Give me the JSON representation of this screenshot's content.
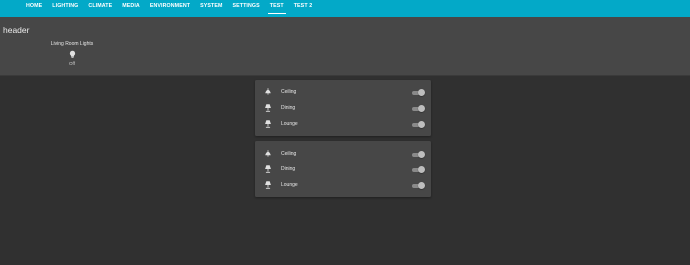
{
  "nav": {
    "tabs": [
      {
        "label": "HOME"
      },
      {
        "label": "LIGHTING"
      },
      {
        "label": "CLIMATE"
      },
      {
        "label": "MEDIA"
      },
      {
        "label": "ENVIRONMENT"
      },
      {
        "label": "SYSTEM"
      },
      {
        "label": "SETTINGS"
      },
      {
        "label": "TEST",
        "active": true
      },
      {
        "label": "TEST 2"
      }
    ]
  },
  "header": {
    "title": "header",
    "entity": {
      "name": "Living Room Lights",
      "state": "Off",
      "icon": "lightbulb-icon"
    }
  },
  "cards": [
    {
      "rows": [
        {
          "label": "Ceiling",
          "icon": "ceiling-light-icon",
          "state": "off"
        },
        {
          "label": "Dining",
          "icon": "lamp-icon",
          "state": "off"
        },
        {
          "label": "Lounge",
          "icon": "lamp-icon",
          "state": "off"
        }
      ]
    },
    {
      "rows": [
        {
          "label": "Ceiling",
          "icon": "ceiling-light-icon",
          "state": "off"
        },
        {
          "label": "Dining",
          "icon": "lamp-icon",
          "state": "off"
        },
        {
          "label": "Lounge",
          "icon": "lamp-icon",
          "state": "off"
        }
      ]
    }
  ],
  "colors": {
    "accent": "#03a9c8",
    "background": "#303030",
    "panel": "#474747",
    "toggle_off_track": "#8a8a8a",
    "toggle_off_knob": "#bdbdbd"
  }
}
